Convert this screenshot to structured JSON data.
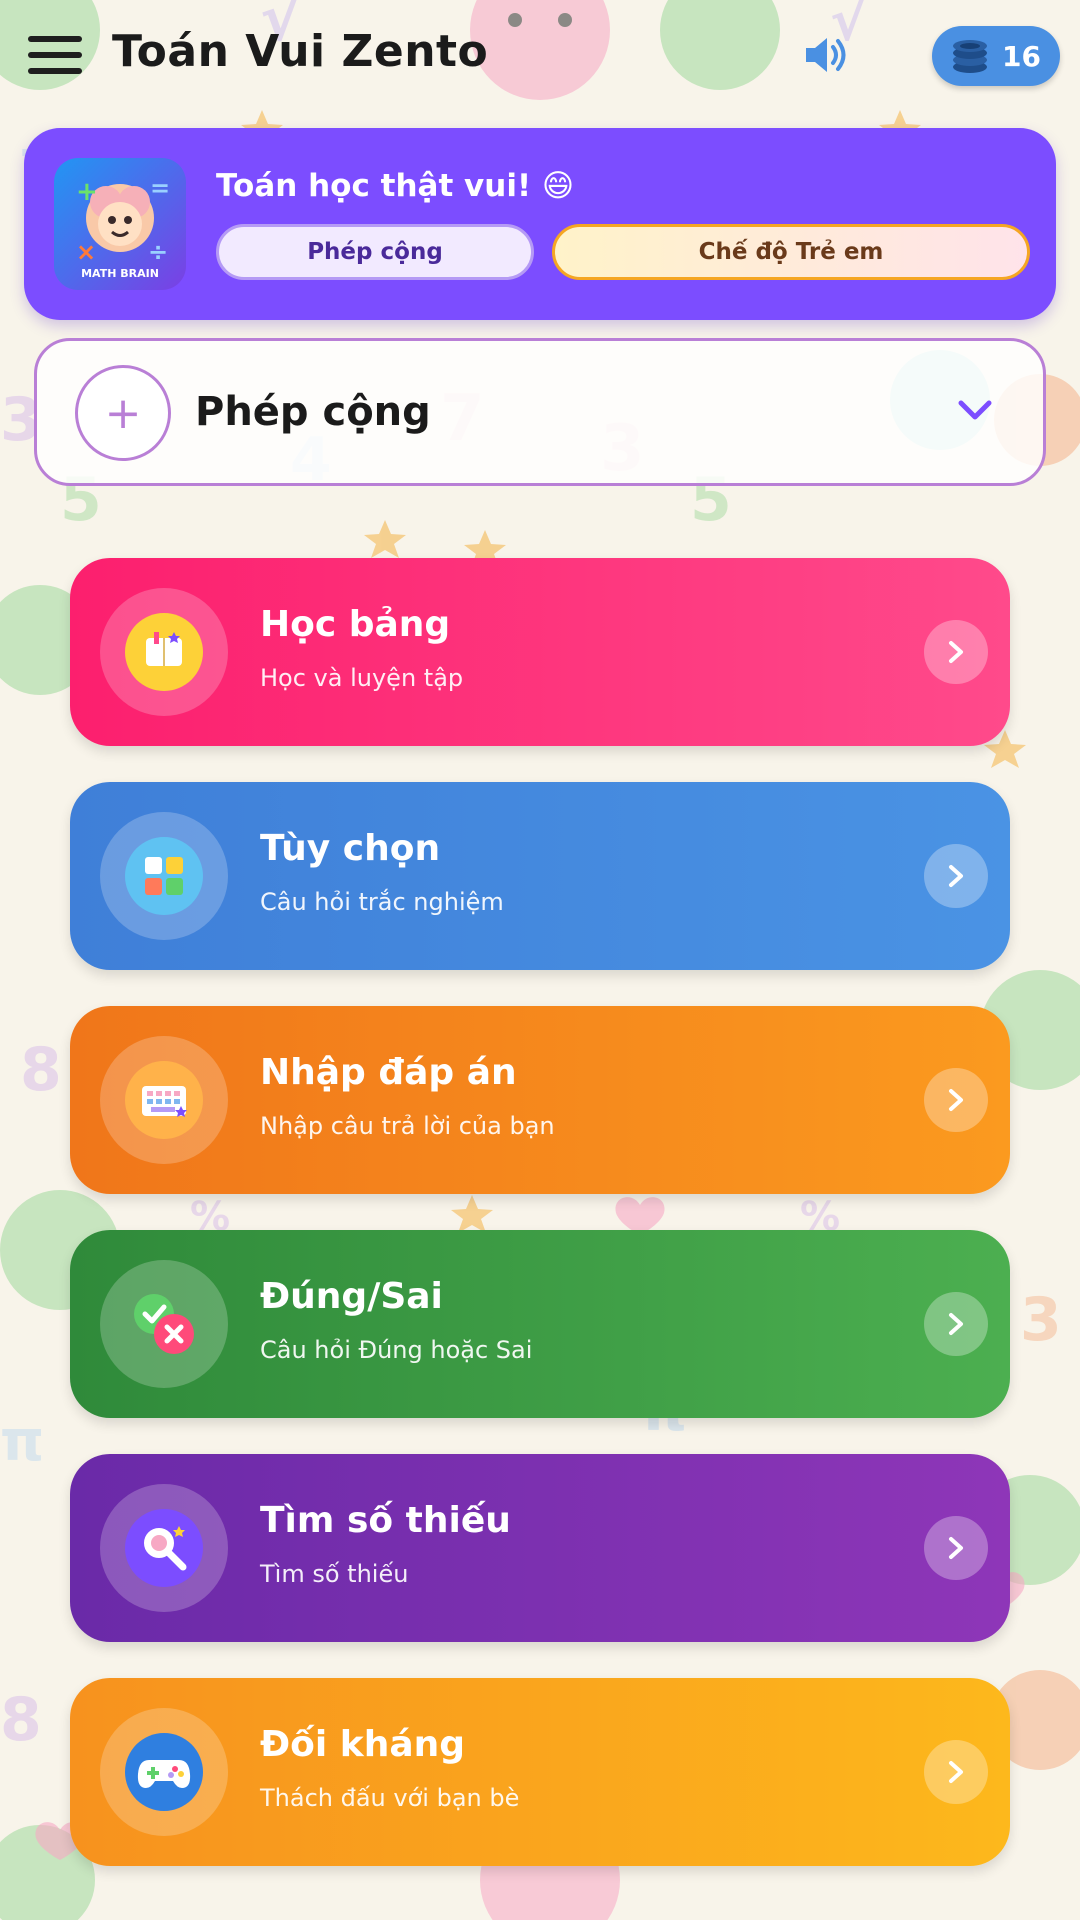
{
  "app": {
    "title": "Toán Vui Zento",
    "coins": "16"
  },
  "header": {
    "logo_text": "MATH BRAIN",
    "tagline": "Toán học thật vui! 😄",
    "operation_chip": "Phép cộng",
    "mode_chip": "Chế độ Trẻ em"
  },
  "operation_select": {
    "symbol": "+",
    "label": "Phép cộng"
  },
  "modes": [
    {
      "title": "Học bảng",
      "subtitle": "Học và luyện tập",
      "icon": "book-icon",
      "color": "#ff2e79"
    },
    {
      "title": "Tùy chọn",
      "subtitle": "Câu hỏi trắc nghiệm",
      "icon": "grid-icon",
      "color": "#4a8ee0"
    },
    {
      "title": "Nhập đáp án",
      "subtitle": "Nhập câu trả lời của bạn",
      "icon": "keyboard-icon",
      "color": "#f7881a"
    },
    {
      "title": "Đúng/Sai",
      "subtitle": "Câu hỏi Đúng hoặc Sai",
      "icon": "check-cross-icon",
      "color": "#43a047"
    },
    {
      "title": "Tìm số thiếu",
      "subtitle": "Tìm số thiếu",
      "icon": "magnifier-icon",
      "color": "#8e2eb8"
    },
    {
      "title": "Đối kháng",
      "subtitle": "Thách đấu với bạn bè",
      "icon": "gamepad-icon",
      "color": "#fba81a"
    }
  ]
}
